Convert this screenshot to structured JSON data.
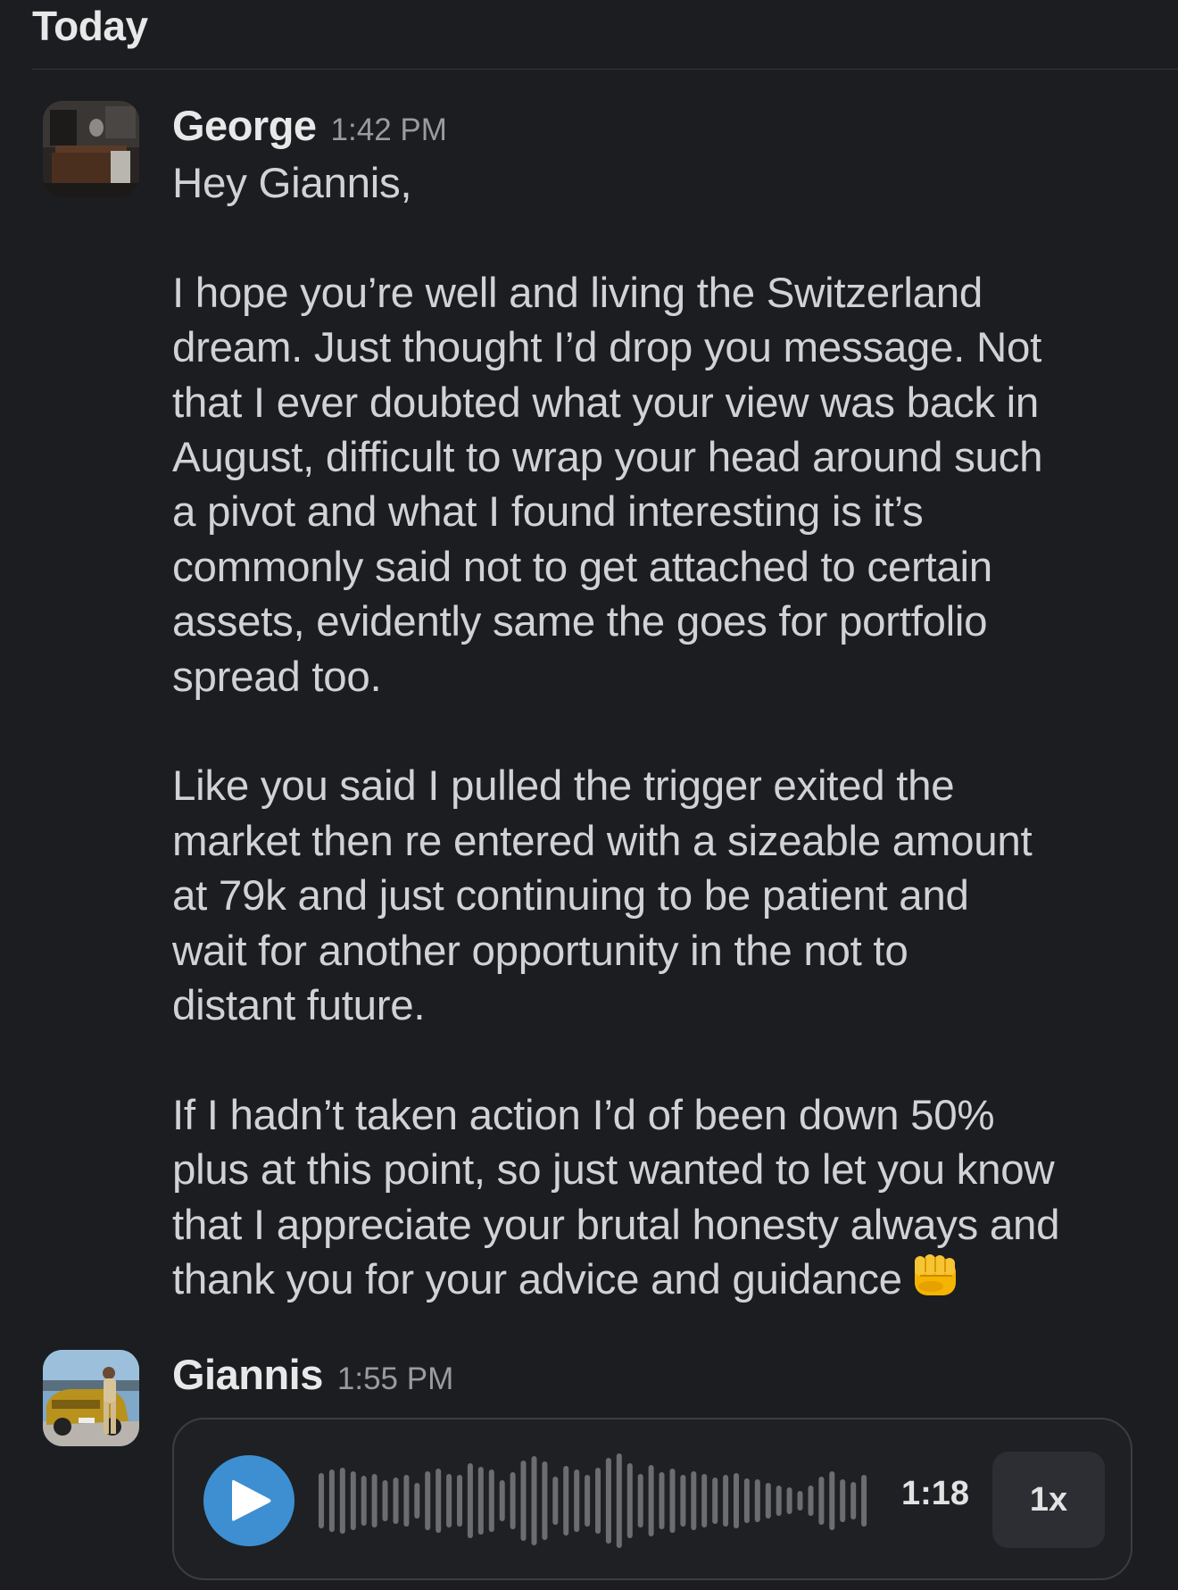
{
  "date_header": "Today",
  "messages": [
    {
      "sender": "George",
      "time": "1:42 PM",
      "text": "Hey Giannis,\n\nI hope you’re well and living the Switzerland\ndream. Just thought I’d drop you message. Not\nthat I ever doubted what your view was back in\nAugust, difficult to wrap your head around such\na pivot and what I found interesting is it’s\ncommonly said not to get attached to certain\nassets, evidently same the goes for portfolio\nspread too.\n\nLike you said I pulled the trigger exited the\nmarket then re entered with a sizeable amount\nat 79k and just continuing to be patient and\nwait for another opportunity in the not to\ndistant future.\n\nIf I hadn’t taken action I’d of been down 50%\nplus at this point, so just wanted to let you know\nthat I appreciate your brutal honesty always and\nthank you for your advice and guidance",
      "emoji": "oncoming-fist-icon"
    },
    {
      "sender": "Giannis",
      "time": "1:55 PM",
      "audio": {
        "duration": "1:18",
        "speed": "1x",
        "play_icon": "play-icon",
        "waveform_icon": "waveform-icon",
        "colors": {
          "play_button": "#3d8fd1",
          "waveform": "#6b6d71"
        }
      }
    }
  ],
  "colors": {
    "background": "#1b1d21",
    "text": "#d1d2d3",
    "muted": "#9a9b9d"
  }
}
